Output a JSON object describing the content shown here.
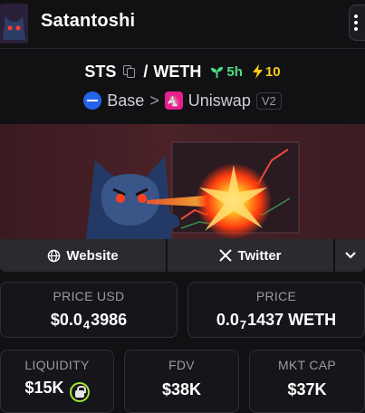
{
  "header": {
    "token_name": "Satantoshi",
    "menu_icon": "vertical-dots-icon"
  },
  "pair": {
    "base_symbol": "STS",
    "separator": "/",
    "quote_symbol": "WETH",
    "age": "5h",
    "boosts": "10",
    "colors": {
      "age": "#4ade80",
      "boost": "#facc15"
    }
  },
  "chain": {
    "network": "Base",
    "dex": "Uniswap",
    "version": "V2",
    "chevron": ">"
  },
  "links": {
    "website": "Website",
    "twitter": "Twitter"
  },
  "stats": {
    "price_usd": {
      "label": "PRICE USD",
      "prefix": "$0.0",
      "zeros": "4",
      "digits": "3986"
    },
    "price_native": {
      "label": "PRICE",
      "prefix": "0.0",
      "zeros": "7",
      "digits": "1437 WETH"
    },
    "liquidity": {
      "label": "LIQUIDITY",
      "value": "$15K"
    },
    "fdv": {
      "label": "FDV",
      "value": "$38K"
    },
    "mkt_cap": {
      "label": "MKT CAP",
      "value": "$37K"
    }
  }
}
